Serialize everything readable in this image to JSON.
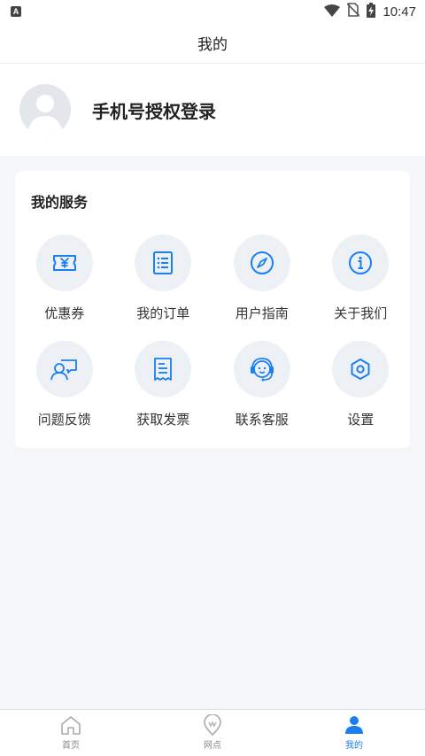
{
  "status_bar": {
    "notification_letter": "A",
    "time": "10:47"
  },
  "header": {
    "title": "我的"
  },
  "profile": {
    "login_label": "手机号授权登录"
  },
  "services": {
    "title": "我的服务",
    "items": [
      {
        "label": "优惠券",
        "icon": "coupon-icon"
      },
      {
        "label": "我的订单",
        "icon": "order-list-icon"
      },
      {
        "label": "用户指南",
        "icon": "compass-icon"
      },
      {
        "label": "关于我们",
        "icon": "info-icon"
      },
      {
        "label": "问题反馈",
        "icon": "feedback-icon"
      },
      {
        "label": "获取发票",
        "icon": "invoice-icon"
      },
      {
        "label": "联系客服",
        "icon": "customer-service-icon"
      },
      {
        "label": "设置",
        "icon": "settings-icon"
      }
    ]
  },
  "tabs": [
    {
      "label": "首页",
      "icon": "home-icon",
      "active": false
    },
    {
      "label": "网点",
      "icon": "location-pin-icon",
      "active": false
    },
    {
      "label": "我的",
      "icon": "user-icon",
      "active": true
    }
  ],
  "colors": {
    "accent": "#1a7ff0",
    "icon_circle": "#edf1f6",
    "background": "#f5f6f8"
  }
}
